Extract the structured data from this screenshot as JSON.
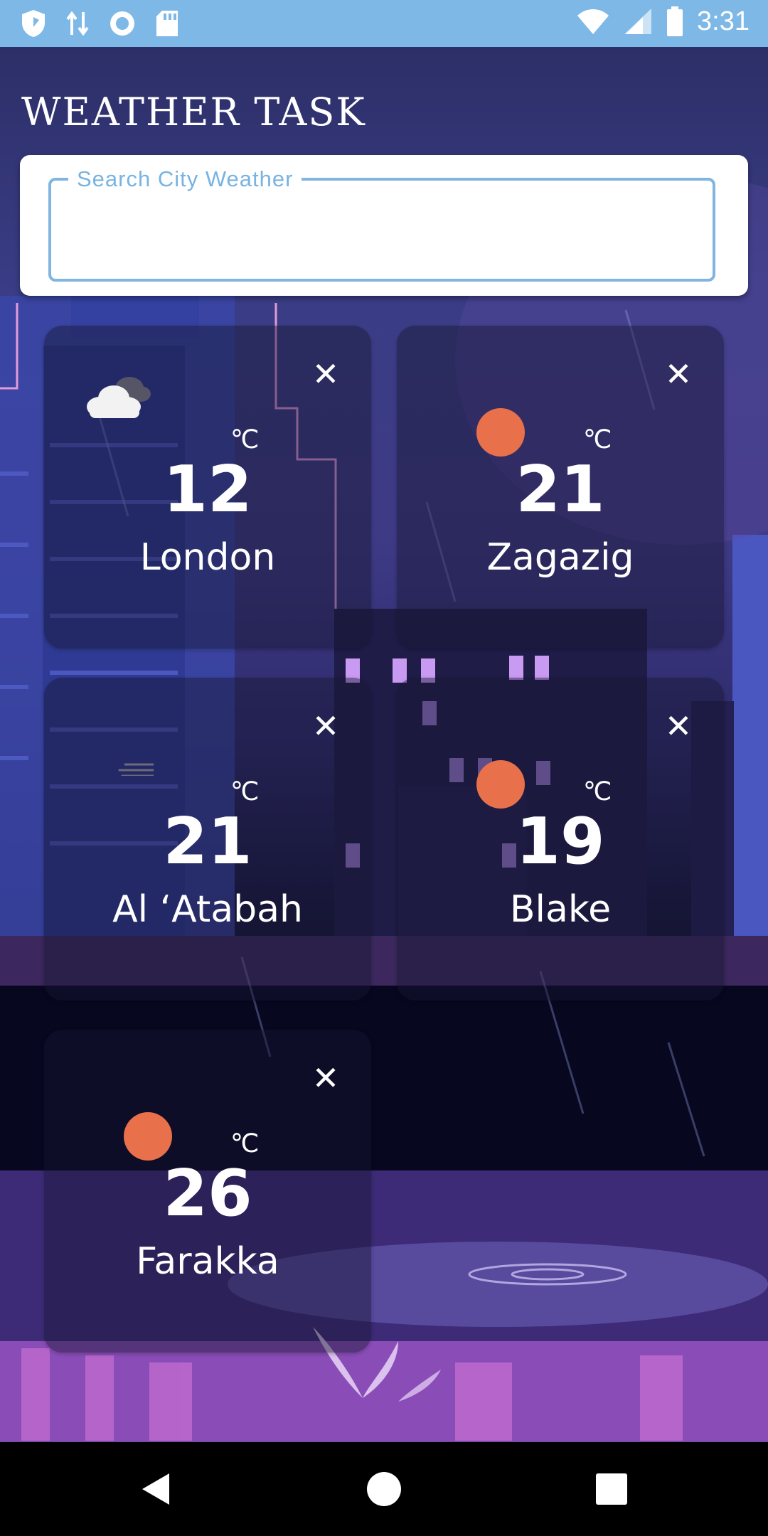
{
  "status_bar": {
    "time": "3:31",
    "left_icons": [
      "shield-icon",
      "data-transfer-icon",
      "record-icon",
      "sd-card-icon"
    ],
    "right_icons": [
      "wifi-icon",
      "cellular-signal-icon",
      "battery-icon"
    ]
  },
  "app": {
    "title": "WEATHER TASK"
  },
  "search": {
    "label": "Search City Weather",
    "value": "",
    "placeholder": ""
  },
  "cards": [
    {
      "city": "London",
      "temp": "12",
      "unit": "℃",
      "icon": "cloud-icon",
      "close": "✕"
    },
    {
      "city": "Zagazig",
      "temp": "21",
      "unit": "℃",
      "icon": "sun-icon",
      "close": "✕"
    },
    {
      "city": "Al ‘Atabah",
      "temp": "21",
      "unit": "℃",
      "icon": "haze-icon",
      "close": "✕"
    },
    {
      "city": "Blake",
      "temp": "19",
      "unit": "℃",
      "icon": "sun-icon",
      "close": "✕"
    },
    {
      "city": "Farakka",
      "temp": "26",
      "unit": "℃",
      "icon": "sun-icon",
      "close": "✕"
    }
  ],
  "colors": {
    "status_bar": "#7db8e6",
    "accent": "#7fb5e0",
    "sun": "#e8704a",
    "card_bg": "rgba(22,22,48,0.45)"
  },
  "nav_bar": {
    "buttons": [
      "back-icon",
      "home-icon",
      "recents-icon"
    ]
  }
}
